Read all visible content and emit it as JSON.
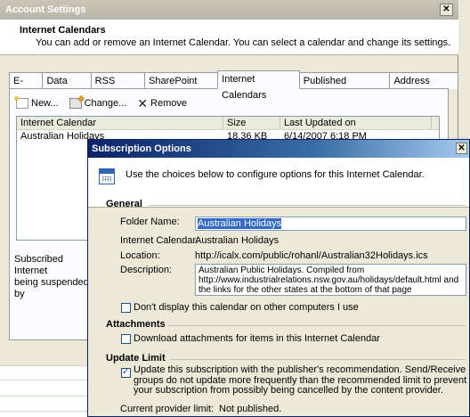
{
  "outer": {
    "title": "Account Settings",
    "close_glyph": "✕",
    "header_title": "Internet Calendars",
    "header_subtitle": "You can add or remove an Internet Calendar. You can select a calendar and change its settings.",
    "tabs": [
      "E-mail",
      "Data Files",
      "RSS Feeds",
      "SharePoint Lists",
      "Internet Calendars",
      "Published Calendars",
      "Address Books"
    ],
    "active_tab": "Internet Calendars",
    "toolbar": {
      "new_label": "New...",
      "change_label": "Change...",
      "remove_label": "Remove"
    },
    "list": {
      "columns": [
        "Internet Calendar",
        "Size",
        "Last Updated on"
      ],
      "rows": [
        {
          "name": "Australian Holidays",
          "size": "18.36 KB",
          "updated": "6/14/2007 6:18 PM"
        }
      ]
    },
    "status_text_1": "Subscribed Internet",
    "status_text_2": "being suspended by"
  },
  "dialog": {
    "title": "Subscription Options",
    "close_glyph": "✕",
    "header_desc": "Use the choices below to configure options for this Internet Calendar.",
    "general": {
      "section_label": "General",
      "folder_name_label": "Folder Name:",
      "folder_name_value": "Australian Holidays",
      "calendar_label": "Internet Calendar:",
      "calendar_value": "Australian Holidays",
      "location_label": "Location:",
      "location_value": "http://icalx.com/public/rohanl/Australian32Holidays.ics",
      "description_label": "Description:",
      "description_value": "Australian Public Holidays. Compiled from http://www.industrialrelations.nsw.gov.au/holidays/default.html and the links for the other states at the bottom of that page",
      "dont_display_label": "Don't display this calendar on other computers I use",
      "dont_display_checked": false
    },
    "attachments": {
      "section_label": "Attachments",
      "download_label": "Download attachments for items in this Internet Calendar",
      "download_checked": false
    },
    "update_limit": {
      "section_label": "Update Limit",
      "update_label": "Update this subscription with the publisher's recommendation. Send/Receive groups do not update more frequently than the recommended limit to prevent your subscription from possibly being cancelled by the content provider.",
      "update_checked": true,
      "provider_limit_label": "Current provider limit:",
      "provider_limit_value": "Not published."
    }
  }
}
